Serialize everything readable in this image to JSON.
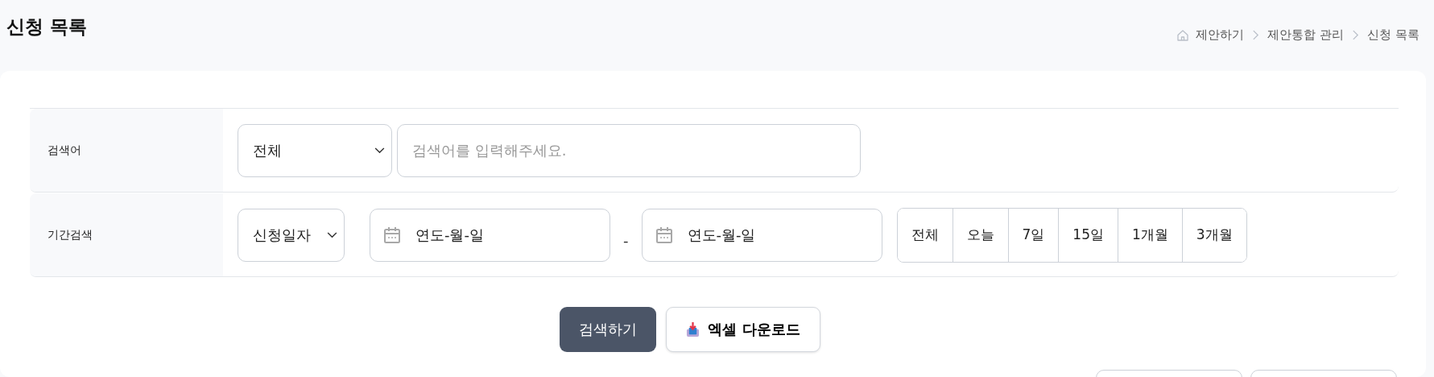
{
  "page_title": "신청 목록",
  "breadcrumb": [
    "제안하기",
    "제안통합 관리",
    "신청 목록"
  ],
  "search_rows": [
    {
      "label": "검색어",
      "kind": "keyword",
      "select": "전체",
      "placeholder": "검색어를 입력해주세요."
    },
    {
      "label": "기간검색",
      "kind": "period",
      "select": "신청일자",
      "date_from": "연도-월-일",
      "separator": "-",
      "date_to": "연도-월-일",
      "periods": [
        "전체",
        "오늘",
        "7일",
        "15일",
        "1개월",
        "3개월"
      ]
    }
  ],
  "actions": {
    "search": "검색하기",
    "excel": "엑셀 다운로드"
  },
  "lower_buttons": [
    {
      "kind": "cut"
    },
    {
      "kind": "cut"
    }
  ]
}
